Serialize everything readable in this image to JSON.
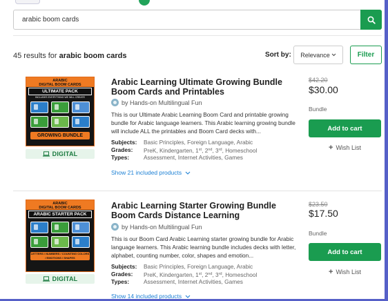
{
  "search": {
    "value": "arabic boom cards"
  },
  "results": {
    "count_text": "45 results for ",
    "query": "arabic boom cards",
    "sort_label": "Sort by:",
    "sort_value": "Relevance",
    "filter_label": "Filter"
  },
  "colors": {
    "accent": "#1a9c50",
    "link": "#1a7fd4",
    "frame": "#5660c8"
  },
  "products": [
    {
      "thumb": {
        "line1": "ARABIC",
        "line2": "DIGITAL BOOM CARDS",
        "pack": "ULTIMATE PACK",
        "tagline": "INCLUDES EVERYTHING WE WILL CREATE",
        "banner": "GROWING BUNDLE"
      },
      "format_tag": "DIGITAL",
      "title": "Arabic Learning Ultimate Growing Bundle Boom Cards and Printables",
      "author": "by Hands-on Multilingual Fun",
      "description": "This is our Ultimate Arabic Learning Boom Card and printable growing bundle for Arabic language learners. This Arabic learning growing bundle will include ALL the printables and Boom Card decks with...",
      "subjects_label": "Subjects:",
      "subjects": "Basic Principles, Foreign Language, Arabic",
      "grades_label": "Grades:",
      "grades_prefix": "PreK, Kindergarten, 1",
      "grades_rest": "Homeschool",
      "types_label": "Types:",
      "types": "Assessment, Internet Activities, Games",
      "show_link": "Show 21 included products",
      "old_price": "$42.20",
      "price": "$30.00",
      "bundle_label": "Bundle",
      "cart_label": "Add to cart",
      "wish_label": "Wish List"
    },
    {
      "thumb": {
        "line1": "ARABIC",
        "line2": "DIGITAL BOOM CARDS",
        "pack": "ARABIC STARTER PACK",
        "tagline": "",
        "banner": "LETTERS / NUMBERS / COUNTING COLORS / EMOTIONS / SHAPES"
      },
      "format_tag": "DIGITAL",
      "title": "Arabic Learning Starter Growing Bundle Boom Cards Distance Learning",
      "author": "by Hands-on Multilingual Fun",
      "description": "This is our Boom Card Arabic Learning starter growing bundle for Arabic language learners. This Arabic learning bundle includes decks with letter, alphabet, counting number, color, shapes and emotion...",
      "subjects_label": "Subjects:",
      "subjects": "Basic Principles, Foreign Language, Arabic",
      "grades_label": "Grades:",
      "grades_prefix": "PreK, Kindergarten, 1",
      "grades_rest": "Homeschool",
      "types_label": "Types:",
      "types": "Assessment, Internet Activities, Games",
      "show_link": "Show 14 included products",
      "old_price": "$23.50",
      "price": "$17.50",
      "bundle_label": "Bundle",
      "cart_label": "Add to cart",
      "wish_label": "Wish List"
    }
  ]
}
